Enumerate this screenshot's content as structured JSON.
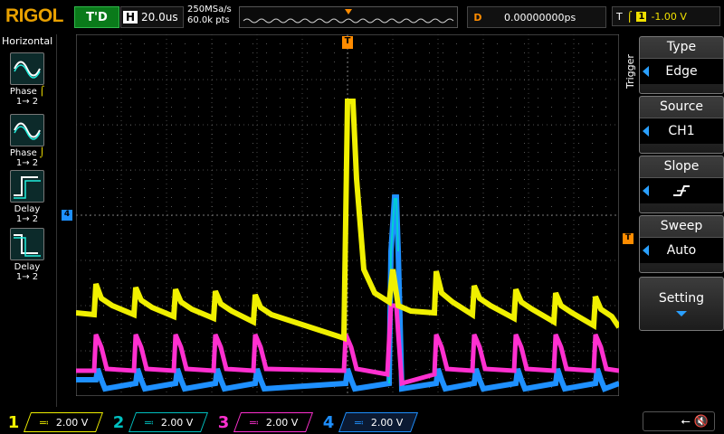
{
  "brand": "RIGOL",
  "top": {
    "run_state": "T'D",
    "horizontal_label": "H",
    "timebase": "20.0us",
    "sample_rate": "250MSa/s",
    "memory_depth": "60.0k pts",
    "delay_label": "D",
    "delay_value": "0.00000000ps",
    "trigger_label": "T",
    "trigger_channel": "1",
    "trigger_level": "-1.00 V"
  },
  "left_menu": {
    "title": "Horizontal",
    "items": [
      {
        "label": "Phase",
        "sub": "1→ 2",
        "icon": "sine-phase-rise-icon"
      },
      {
        "label": "Phase",
        "sub": "1→ 2",
        "icon": "sine-phase-fall-icon"
      },
      {
        "label": "Delay",
        "sub": "1→ 2",
        "icon": "delay-rise-rise-icon"
      },
      {
        "label": "Delay",
        "sub": "1→ 2",
        "icon": "delay-fall-fall-icon"
      }
    ]
  },
  "right_menu": {
    "title": "Trigger",
    "type_label": "Type",
    "type_value": "Edge",
    "source_label": "Source",
    "source_value": "CH1",
    "slope_label": "Slope",
    "sweep_label": "Sweep",
    "sweep_value": "Auto",
    "setting_label": "Setting"
  },
  "channels": [
    {
      "num": "1",
      "scale": "2.00 V",
      "color": "#f0f000"
    },
    {
      "num": "2",
      "scale": "2.00 V",
      "color": "#00c0c0"
    },
    {
      "num": "3",
      "scale": "2.00 V",
      "color": "#ff30d0"
    },
    {
      "num": "4",
      "scale": "2.00 V",
      "color": "#1e90ff"
    }
  ],
  "markers": {
    "trigger_pos": "T",
    "ch4_ref": "4",
    "trigger_level_marker": "T"
  }
}
